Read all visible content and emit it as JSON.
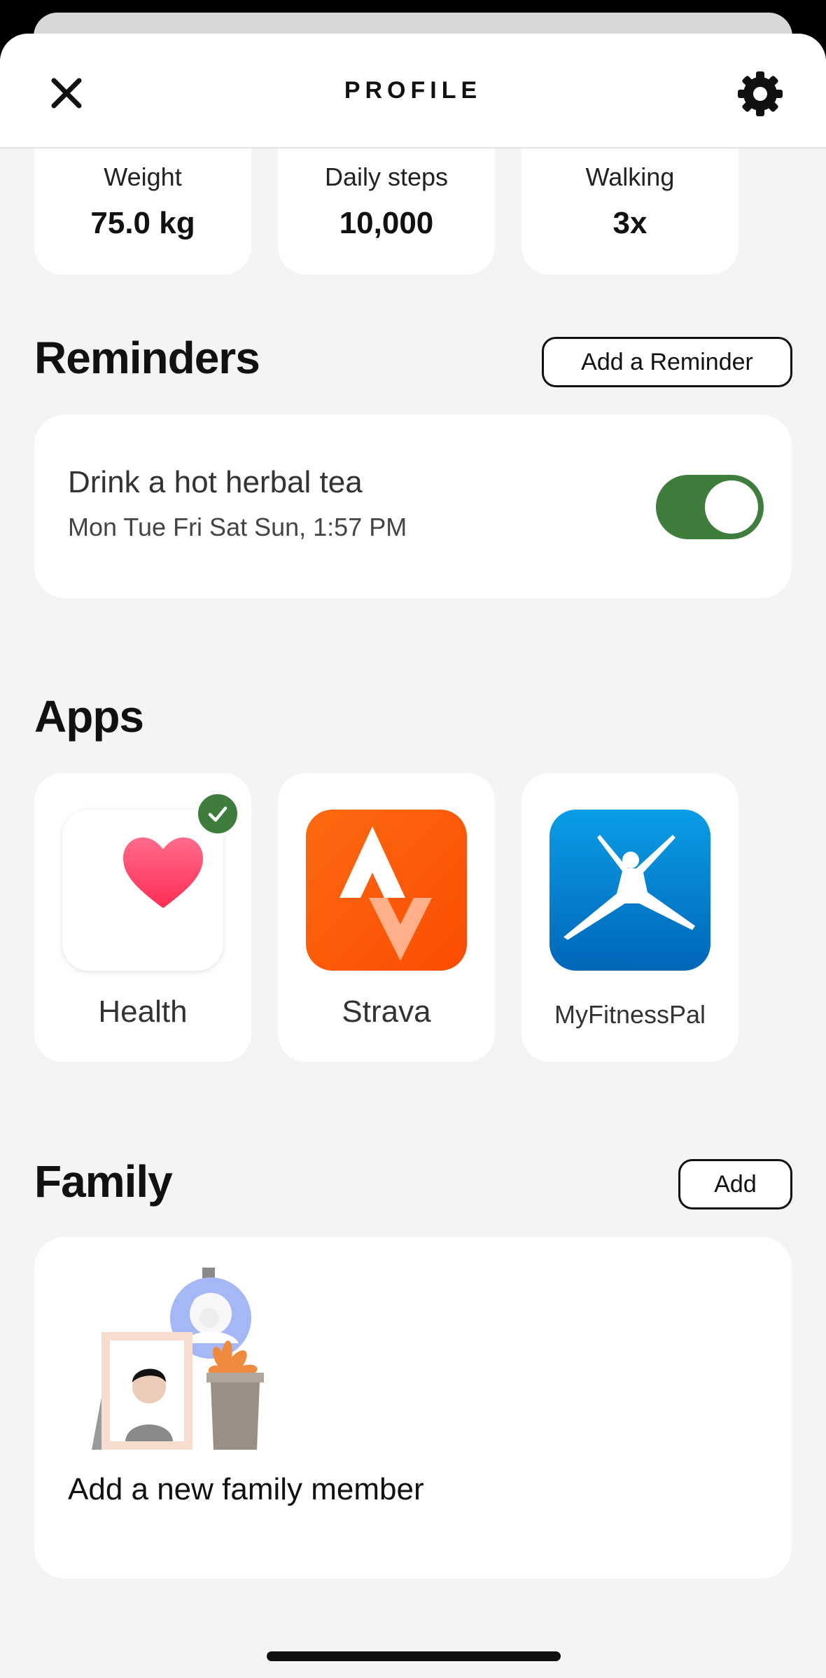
{
  "header": {
    "title": "PROFILE",
    "close_icon": "close-icon",
    "settings_icon": "gear-icon"
  },
  "stats": [
    {
      "label": "Weight",
      "value": "75.0 kg"
    },
    {
      "label": "Daily steps",
      "value": "10,000"
    },
    {
      "label": "Walking",
      "value": "3x"
    }
  ],
  "reminders": {
    "title": "Reminders",
    "add_label": "Add a Reminder",
    "items": [
      {
        "title": "Drink a hot herbal tea",
        "schedule": "Mon Tue Fri Sat Sun, 1:57 PM",
        "enabled": true
      }
    ]
  },
  "apps": {
    "title": "Apps",
    "items": [
      {
        "name": "Health",
        "icon": "heart-icon",
        "connected": true
      },
      {
        "name": "Strava",
        "icon": "strava-logo-icon",
        "connected": false
      },
      {
        "name": "MyFitnessPal",
        "icon": "myfitnesspal-logo-icon",
        "connected": false
      }
    ]
  },
  "family": {
    "title": "Family",
    "add_label": "Add",
    "empty_text": "Add a new family member"
  },
  "colors": {
    "accent_green": "#3f7d3c",
    "background": "#f4f4f4",
    "card": "#ffffff",
    "strava_orange": "#fc5200",
    "myfitnesspal_blue": "#0072c6"
  }
}
